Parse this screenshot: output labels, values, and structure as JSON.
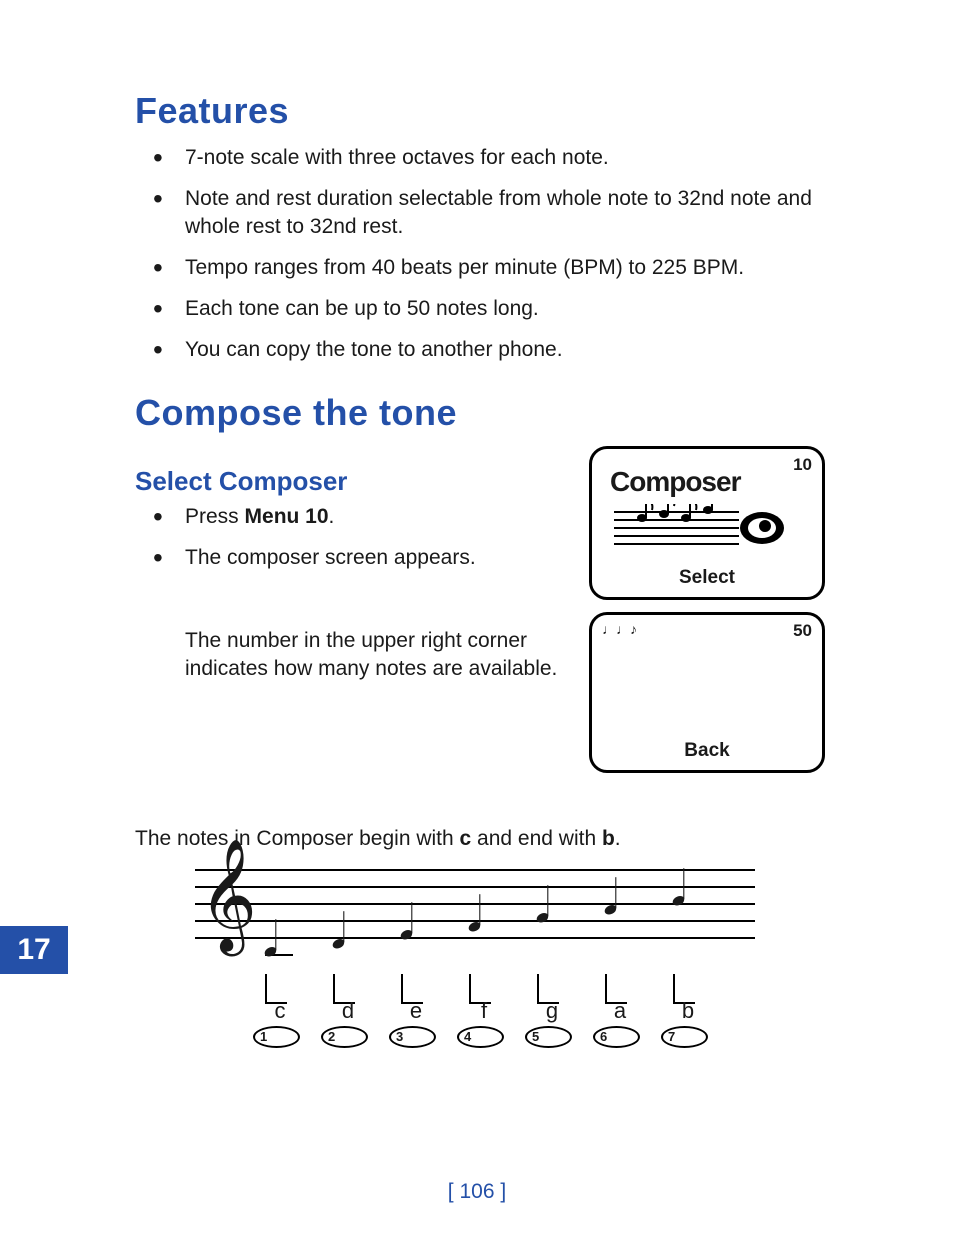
{
  "headings": {
    "features": "Features",
    "compose": "Compose the tone",
    "select": "Select Composer"
  },
  "features_list": [
    "7-note scale with three octaves for each note.",
    "Note and rest duration selectable from whole note to 32nd note and whole rest to 32nd rest.",
    "Tempo ranges from 40 beats per minute (BPM) to 225 BPM.",
    "Each tone can be up to 50 notes long.",
    "You can copy the tone to another phone."
  ],
  "select_steps": {
    "press_prefix": "Press ",
    "press_bold": "Menu 10",
    "press_suffix": ".",
    "appears": "The composer screen appears."
  },
  "note_count_desc": "The number in the upper right corner indicates how many notes are available.",
  "intro": {
    "prefix": "The notes in Composer begin with ",
    "c": "c",
    "mid": " and end with ",
    "b": "b",
    "suffix": "."
  },
  "lcd1": {
    "corner": "10",
    "title": "Composer",
    "softkey": "Select"
  },
  "lcd2": {
    "corner": "50",
    "tiny": "♩♩♪",
    "softkey": "Back"
  },
  "scale": {
    "notes": [
      {
        "letter": "c",
        "key": "1"
      },
      {
        "letter": "d",
        "key": "2"
      },
      {
        "letter": "e",
        "key": "3"
      },
      {
        "letter": "f",
        "key": "4"
      },
      {
        "letter": "g",
        "key": "5"
      },
      {
        "letter": "a",
        "key": "6"
      },
      {
        "letter": "b",
        "key": "7"
      }
    ]
  },
  "chapter": "17",
  "page_number": "[ 106 ]"
}
